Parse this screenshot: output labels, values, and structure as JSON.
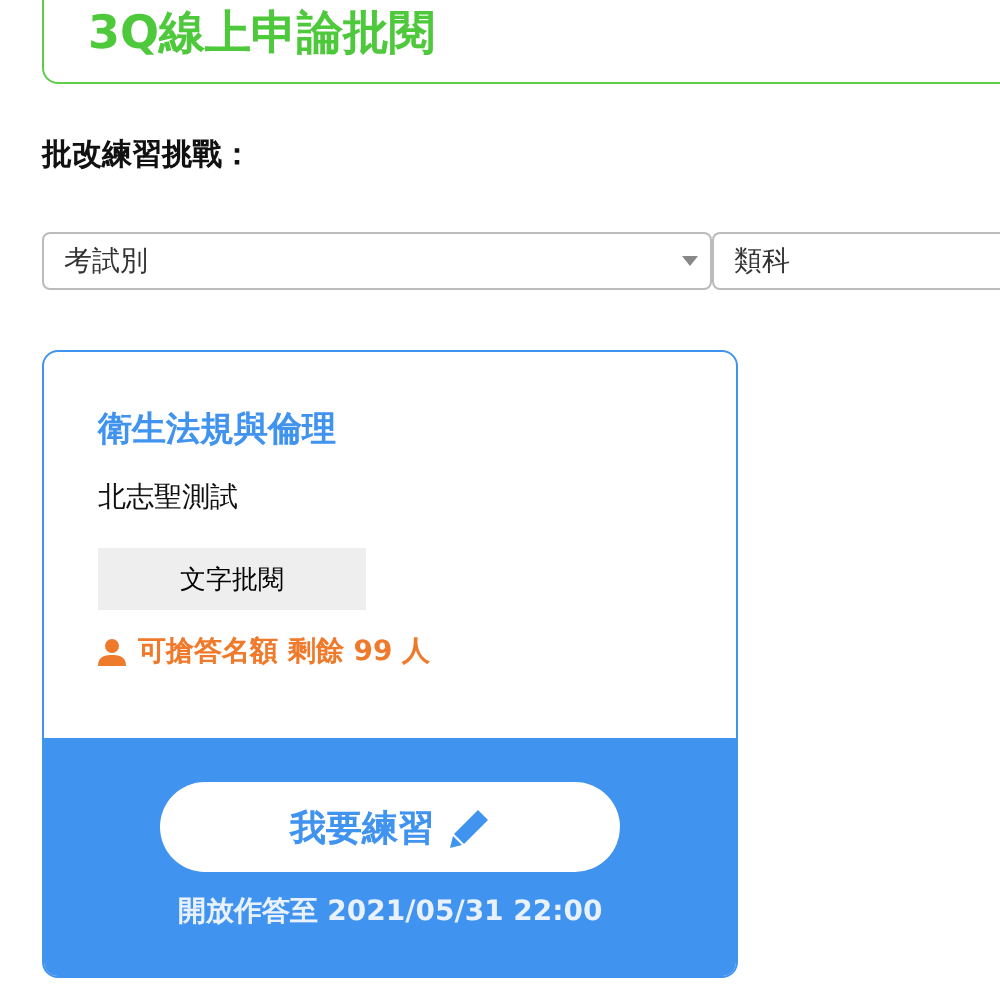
{
  "header": {
    "title": "3Q線上申論批閱"
  },
  "section_label": "批改練習挑戰：",
  "filters": [
    {
      "placeholder": "考試別",
      "has_caret": true
    },
    {
      "placeholder": "類科",
      "has_caret": false
    }
  ],
  "card": {
    "title": "衛生法規與倫理",
    "subtitle": "北志聖測試",
    "tag": "文字批閱",
    "quota": "可搶答名額 剩餘 99 人",
    "button": "我要練習",
    "deadline": "開放作答至 2021/05/31 22:00"
  }
}
